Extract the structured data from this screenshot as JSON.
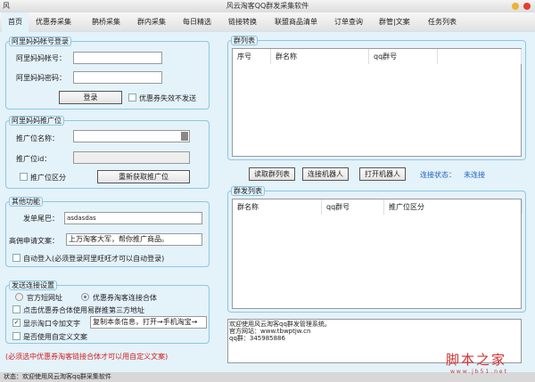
{
  "window": {
    "title": "风云淘客QQ群发采集软件",
    "logo": "风"
  },
  "tabs": [
    "首页",
    "优惠券采集",
    "鹊桥采集",
    "群内采集",
    "每日精选",
    "链接转换",
    "联盟商品清单",
    "订单查询",
    "群管|文案",
    "任务列表"
  ],
  "login": {
    "title": "阿里妈妈帐号登录",
    "account_label": "阿里妈妈帐号：",
    "account_value": "",
    "password_label": "阿里妈妈密码：",
    "password_value": "",
    "login_button": "登录",
    "coupon_invalid_label": "优惠券失效不发送"
  },
  "adzone": {
    "title": "阿里妈妈推广位",
    "name_label": "推广位名称：",
    "name_value": "",
    "id_label": "推广位id：",
    "id_value": "",
    "distinguish_label": "推广位区分",
    "refresh_button": "重新获取推广位"
  },
  "other": {
    "title": "其他功能",
    "tail_label": "发单尾巴：",
    "tail_value": "asdasdas",
    "apply_label": "高佣申请文案：",
    "apply_value": "上万淘客大军，帮你推广商品。",
    "autologin_label": "自动登入(必须登录阿里旺旺才可以自动登录)"
  },
  "send": {
    "title": "发送连接设置",
    "radio_official": "官方短网址",
    "radio_combo": "优惠券淘客连接合体",
    "opt_third": "点击优惠券合体使用易群推第三方地址",
    "opt_tkl": "显示淘口令加文字",
    "tkl_value": "复制本条信息，打开→手机淘宝→",
    "opt_custom": "是否使用自定义文案",
    "note": "(必须选中优惠券淘客链接合体才可以用自定义文案)"
  },
  "group_list": {
    "title": "群列表",
    "columns": [
      "序号",
      "群名称",
      "qq群号",
      ""
    ]
  },
  "actions": {
    "read": "读取群列表",
    "connect": "连接机器人",
    "open": "打开机器人",
    "status_label": "连接状态：",
    "status_value": "未连接"
  },
  "send_list": {
    "title": "群发列表",
    "columns": [
      "群名称",
      "qq群号",
      "推广位区分"
    ]
  },
  "log": [
    "欢迎使用风云淘客qq群发管理系统。",
    "官方网站：www.tbwptjw.cn",
    "qq群：345985886"
  ],
  "watermark": {
    "title": "脚本之家",
    "url": "www.jb51.net"
  },
  "status": "状态：欢迎使用风云淘客qq群采集软件",
  "colors": {
    "accent": "#8cc8e2",
    "link": "#2060c0",
    "note": "#d02020"
  }
}
